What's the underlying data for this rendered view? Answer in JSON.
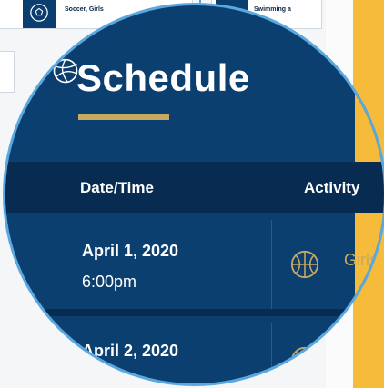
{
  "background": {
    "cards": [
      {
        "label": "Soccer, Girls",
        "icon": "soccer-ball-icon"
      },
      {
        "label": "Swimming a",
        "icon": "swimming-icon"
      },
      {
        "label": "",
        "icon": "volleyball-icon"
      }
    ]
  },
  "schedule": {
    "title": "Schedule",
    "columns": {
      "datetime": "Date/Time",
      "activity": "Activity"
    },
    "rows": [
      {
        "date": "April 1, 2020",
        "time": "6:00pm",
        "activity": "Girls",
        "icon": "basketball-icon"
      },
      {
        "date": "April 2, 2020",
        "time": "",
        "activity": "",
        "icon": "basketball-icon"
      }
    ]
  },
  "colors": {
    "navy": "#0b3f6f",
    "header_navy": "#082c51",
    "gold": "#c7a962",
    "accent_yellow": "#f6bb3a",
    "lens_ring": "#5ba8e0"
  }
}
